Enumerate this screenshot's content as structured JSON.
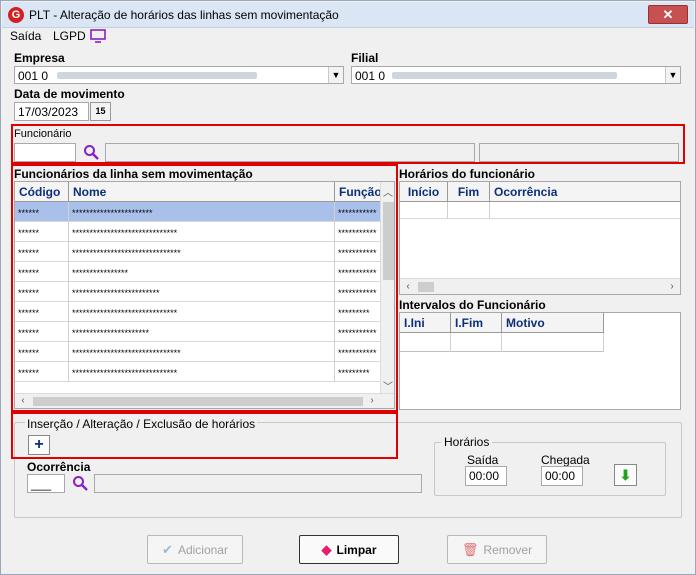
{
  "window": {
    "title": "PLT - Alteração de horários das linhas sem movimentação",
    "close_glyph": "✕",
    "app_icon_letter": "G"
  },
  "menu": {
    "items": [
      "Saída",
      "LGPD"
    ],
    "monitor_icon": "monitor-icon"
  },
  "empresa": {
    "label": "Empresa",
    "value": "001 0"
  },
  "filial": {
    "label": "Filial",
    "value": "001 0"
  },
  "data_movimento": {
    "label": "Data de movimento",
    "value": "17/03/2023",
    "cal_glyph": "15"
  },
  "funcionario": {
    "label": "Funcionário",
    "value": ""
  },
  "func_grid": {
    "title": "Funcionários da linha sem movimentação",
    "columns": [
      "Código",
      "Nome",
      "Função"
    ],
    "rows": [
      [
        "******",
        "***********************",
        "***********"
      ],
      [
        "******",
        "******************************",
        "***********"
      ],
      [
        "******",
        "*******************************",
        "***********"
      ],
      [
        "******",
        "****************",
        "***********"
      ],
      [
        "******",
        "*************************",
        "***********"
      ],
      [
        "******",
        "******************************",
        "*********"
      ],
      [
        "******",
        "**********************",
        "***********"
      ],
      [
        "******",
        "*******************************",
        "***********"
      ],
      [
        "******",
        "******************************",
        "*********"
      ]
    ]
  },
  "horarios_grid": {
    "title": "Horários do funcionário",
    "columns": [
      "Início",
      "Fim",
      "Ocorrência"
    ]
  },
  "intervalos_grid": {
    "title": "Intervalos do Funcionário",
    "columns": [
      "I.Ini",
      "I.Fim",
      "Motivo"
    ]
  },
  "insercao": {
    "title": "Inserção / Alteração / Exclusão de horários",
    "add_glyph": "+"
  },
  "ocorrencia": {
    "label": "Ocorrência",
    "value": "___"
  },
  "horarios": {
    "title": "Horários",
    "saida_label": "Saída",
    "saida_value": "00:00",
    "chegada_label": "Chegada",
    "chegada_value": "00:00",
    "confirm_glyph": "⬇"
  },
  "buttons": {
    "adicionar": {
      "label": "Adicionar",
      "glyph": "✔"
    },
    "limpar": {
      "label": "Limpar",
      "glyph": "◆"
    },
    "remover": {
      "label": "Remover",
      "glyph": "🗑"
    }
  },
  "colors": {
    "title_bar": "#dbe6f4",
    "header_text": "#0b2f7a",
    "selected_row": "#a8c0ea",
    "highlight_border": "#e00000",
    "search_icon": "#8a1fc4",
    "green_arrow": "#21a11f"
  }
}
